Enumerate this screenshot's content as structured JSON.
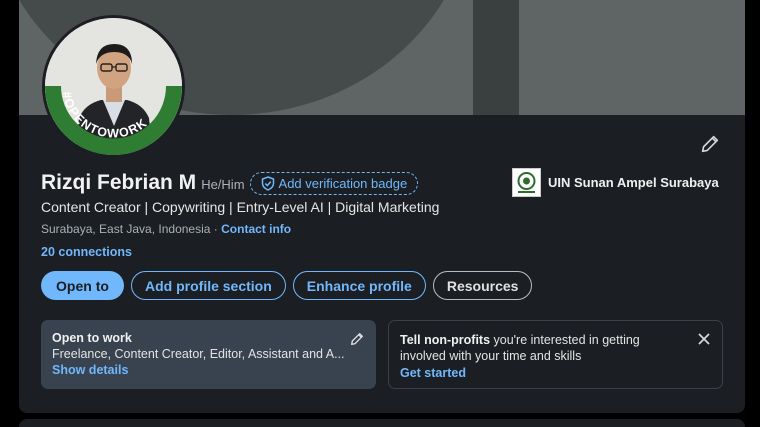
{
  "profile": {
    "name": "Rizqi Febrian M",
    "pronouns": "He/Him",
    "verify_label": "Add verification badge",
    "headline": "Content Creator | Copywriting | Entry-Level AI | Digital Marketing",
    "location": "Surabaya, East Java, Indonesia",
    "location_sep": " · ",
    "contact_label": "Contact info",
    "connections": "20 connections",
    "frame_text": "#OPENTOWORK"
  },
  "education": {
    "school_name": "UIN Sunan Ampel Surabaya"
  },
  "actions": {
    "open_to": "Open to",
    "add_section": "Add profile section",
    "enhance": "Enhance profile",
    "resources": "Resources"
  },
  "open_to_work": {
    "title": "Open to work",
    "roles": "Freelance, Content Creator, Editor, Assistant and A...",
    "link": "Show details"
  },
  "nonprofit": {
    "lead": "Tell non-profits",
    "text": " you're interested in getting involved with your time and skills",
    "link": "Get started"
  },
  "colors": {
    "accent": "#71b7fb",
    "card_bg": "#1b1f23",
    "open_to_work_green": "#2e7d32"
  },
  "icons": [
    "pencil-icon",
    "shield-check-icon",
    "close-icon",
    "school-logo"
  ]
}
